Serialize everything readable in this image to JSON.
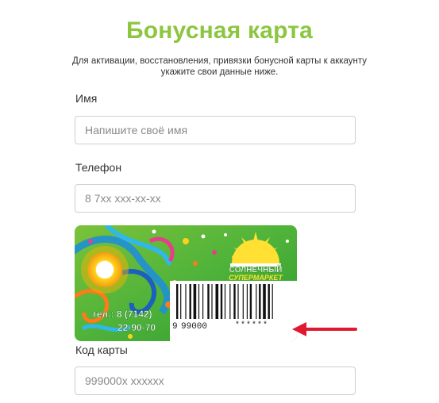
{
  "page": {
    "title": "Бонусная карта",
    "subtitle_line1": "Для активации, восстановления, привязки бонусной карты к аккаунту",
    "subtitle_line2": "укажите свои данные ниже."
  },
  "form": {
    "name_label": "Имя",
    "name_placeholder": "Напишите своё имя",
    "phone_label": "Телефон",
    "phone_placeholder": "8 7хх ххх-хх-хх",
    "card_label": "Код карты",
    "card_placeholder": "999000х хххххх"
  },
  "card": {
    "brand_line1": "СОЛНЕЧНЫЙ",
    "brand_line2": "СУПЕРМАРКЕТ",
    "phone_line1": "тел.: 8 (7142)",
    "phone_line2": "22-90-70",
    "barcode_digit": "9",
    "barcode_number": "99000",
    "barcode_masked": "******"
  },
  "colors": {
    "accent": "#8cc63f",
    "arrow": "#e0192f"
  }
}
